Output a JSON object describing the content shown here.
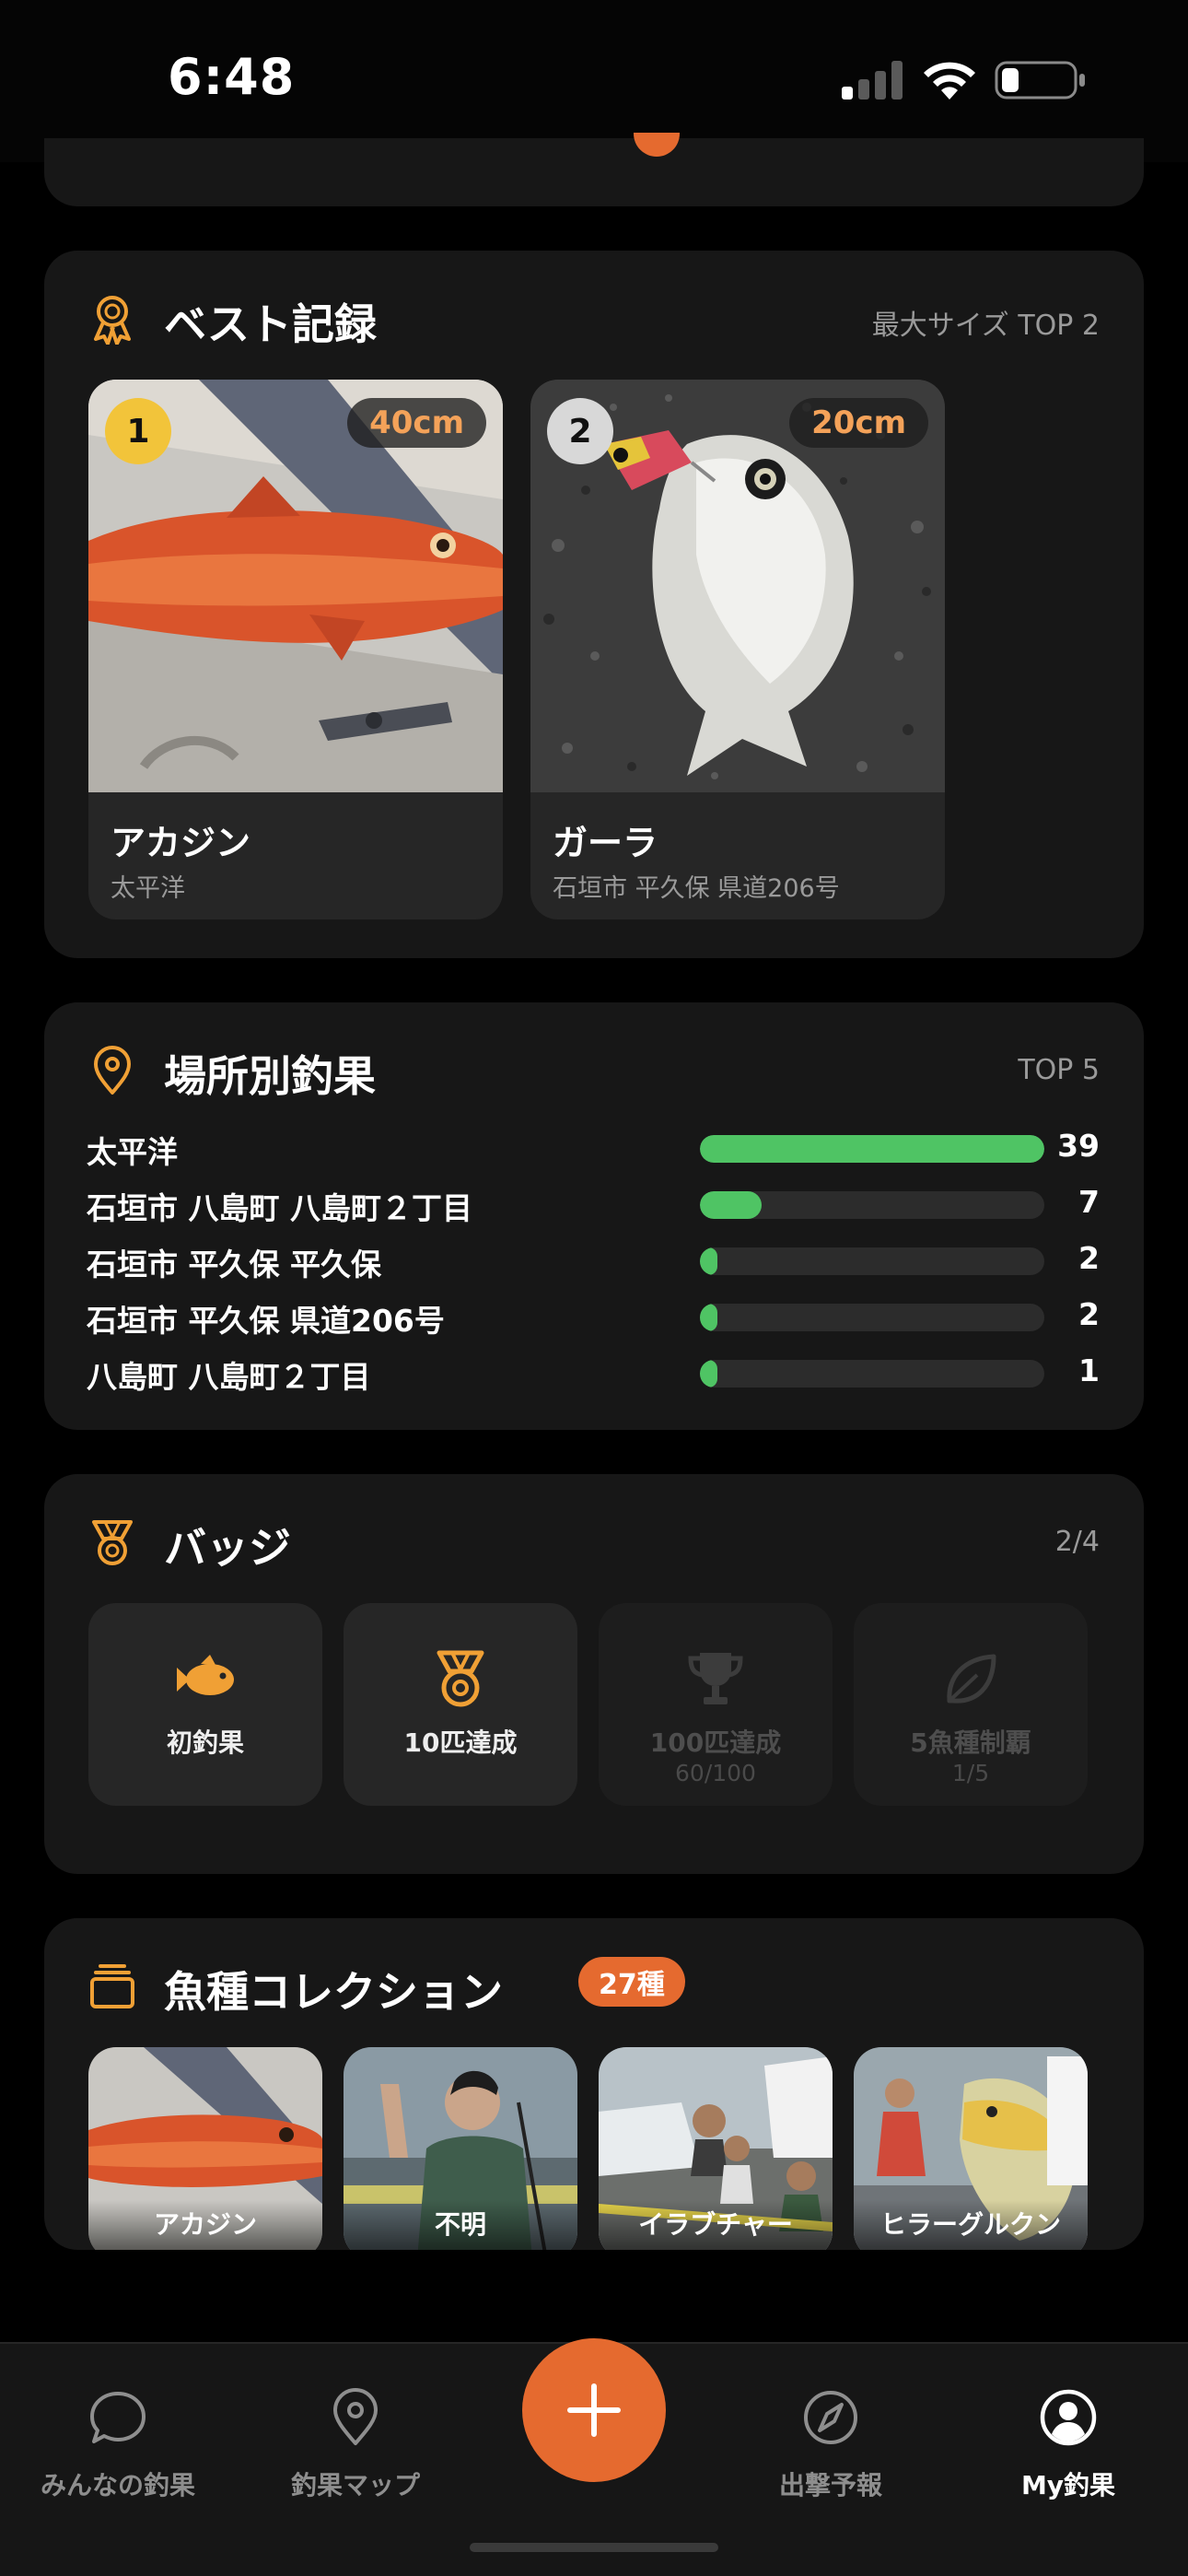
{
  "status_bar": {
    "time": "6:48"
  },
  "best_records": {
    "title": "ベスト記録",
    "meta": "最大サイズ TOP 2",
    "icon": "award-ribbon-icon",
    "items": [
      {
        "rank": "1",
        "size": "40cm",
        "name": "アカジン",
        "location": "太平洋",
        "rank_color": "#f2c43a"
      },
      {
        "rank": "2",
        "size": "20cm",
        "name": "ガーラ",
        "location": "石垣市 平久保 県道206号",
        "rank_color": "#d8d8d8"
      }
    ]
  },
  "locations": {
    "title": "場所別釣果",
    "meta": "TOP 5",
    "icon": "map-pin-icon",
    "max": 39,
    "bar_color": "#4fc464",
    "rows": [
      {
        "name": "太平洋",
        "count": "39",
        "value": 39
      },
      {
        "name": "石垣市 八島町 八島町２丁目",
        "count": "7",
        "value": 7
      },
      {
        "name": "石垣市 平久保 平久保",
        "count": "2",
        "value": 2
      },
      {
        "name": "石垣市 平久保 県道206号",
        "count": "2",
        "value": 2
      },
      {
        "name": "八島町 八島町２丁目",
        "count": "1",
        "value": 1
      }
    ]
  },
  "badges": {
    "title": "バッジ",
    "meta": "2/4",
    "icon": "medal-icon",
    "items": [
      {
        "label": "初釣果",
        "icon": "fish-icon",
        "unlocked": true,
        "progress": ""
      },
      {
        "label": "10匹達成",
        "icon": "medal-icon",
        "unlocked": true,
        "progress": ""
      },
      {
        "label": "100匹達成",
        "icon": "trophy-icon",
        "unlocked": false,
        "progress": "60/100"
      },
      {
        "label": "5魚種制覇",
        "icon": "leaf-icon",
        "unlocked": false,
        "progress": "1/5"
      }
    ]
  },
  "collection": {
    "title": "魚種コレクション",
    "count": "27種",
    "icon": "stack-icon",
    "items": [
      {
        "label": "アカジン"
      },
      {
        "label": "不明"
      },
      {
        "label": "イラブチャー"
      },
      {
        "label": "ヒラーグルクン"
      }
    ]
  },
  "tab_bar": {
    "tabs": [
      {
        "label": "みんなの釣果",
        "icon": "chat-bubble-icon",
        "active": false
      },
      {
        "label": "釣果マップ",
        "icon": "map-pin-icon",
        "active": false
      },
      {
        "label": "出撃予報",
        "icon": "compass-icon",
        "active": false
      },
      {
        "label": "My釣果",
        "icon": "profile-icon",
        "active": true
      }
    ],
    "fab_icon": "plus-icon"
  },
  "colors": {
    "accent": "#e56a2f",
    "icon_accent": "#f0a035",
    "card": "#171717"
  }
}
